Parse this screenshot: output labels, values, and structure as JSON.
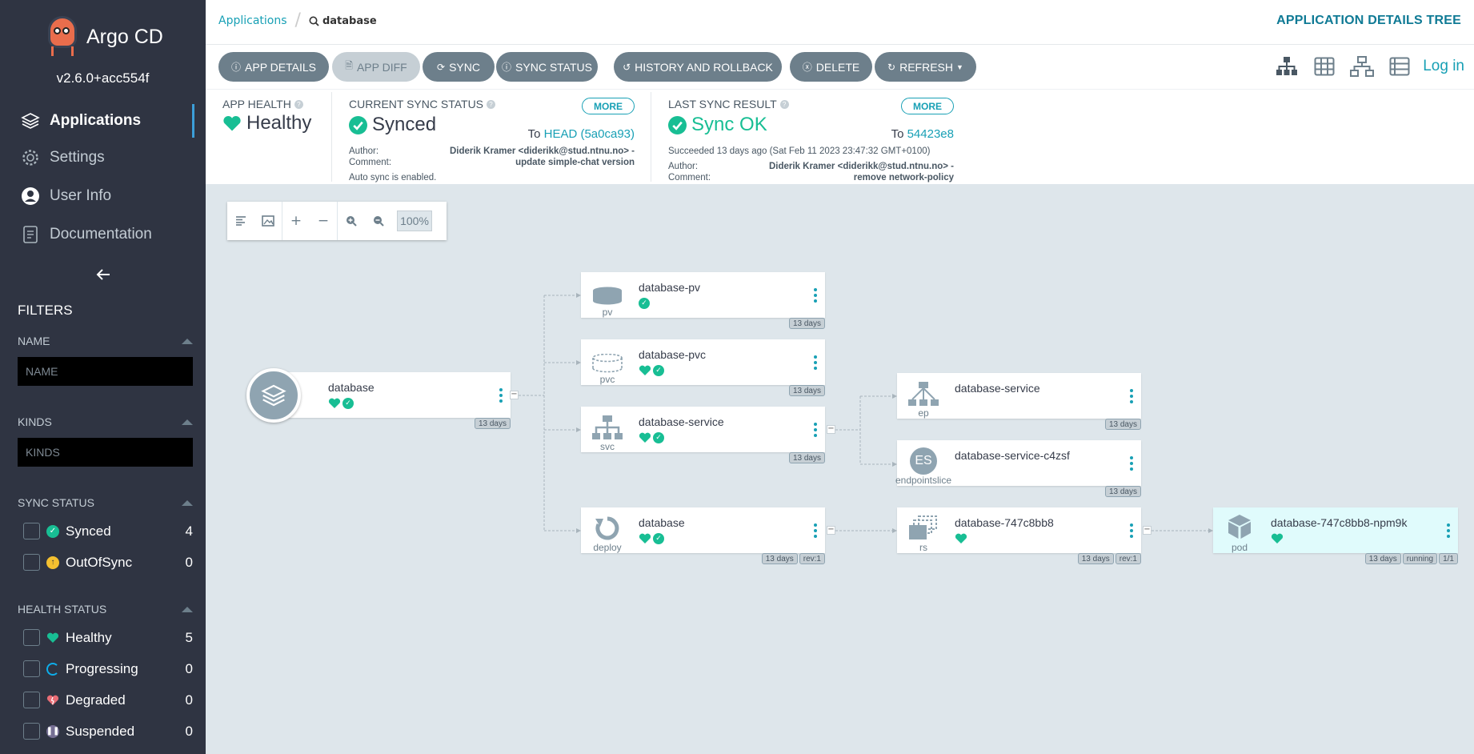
{
  "app": {
    "name": "Argo CD",
    "version": "v2.6.0+acc554f"
  },
  "nav": [
    {
      "label": "Applications"
    },
    {
      "label": "Settings"
    },
    {
      "label": "User Info"
    },
    {
      "label": "Documentation"
    }
  ],
  "filters": {
    "title": "FILTERS",
    "name": {
      "title": "NAME",
      "placeholder": "NAME"
    },
    "kinds": {
      "title": "KINDS",
      "placeholder": "KINDS"
    },
    "sync": {
      "title": "SYNC STATUS",
      "items": [
        {
          "label": "Synced",
          "count": "4"
        },
        {
          "label": "OutOfSync",
          "count": "0"
        }
      ]
    },
    "health": {
      "title": "HEALTH STATUS",
      "items": [
        {
          "label": "Healthy",
          "count": "5"
        },
        {
          "label": "Progressing",
          "count": "0"
        },
        {
          "label": "Degraded",
          "count": "0"
        },
        {
          "label": "Suspended",
          "count": "0"
        }
      ]
    }
  },
  "breadcrumb": {
    "root": "Applications",
    "current": "database"
  },
  "header": {
    "title": "APPLICATION DETAILS TREE"
  },
  "toolbar": {
    "app_details": "APP DETAILS",
    "app_diff": "APP DIFF",
    "sync": "SYNC",
    "sync_status": "SYNC STATUS",
    "history": "HISTORY AND ROLLBACK",
    "delete": "DELETE",
    "refresh": "REFRESH",
    "login": "Log in"
  },
  "status": {
    "health": {
      "label": "APP HEALTH",
      "value": "Healthy"
    },
    "sync": {
      "label": "CURRENT SYNC STATUS",
      "value": "Synced",
      "more": "MORE",
      "to_prefix": "To",
      "to_rev": "HEAD (5a0ca93)",
      "author_label": "Author:",
      "comment_label": "Comment:",
      "author": "Diderik Kramer <diderikk@stud.ntnu.no> -",
      "comment": "update simple-chat version",
      "auto": "Auto sync is enabled."
    },
    "last": {
      "label": "LAST SYNC RESULT",
      "value": "Sync OK",
      "more": "MORE",
      "to_prefix": "To",
      "to_rev": "54423e8",
      "succeeded": "Succeeded 13 days ago (Sat Feb 11 2023 23:47:32 GMT+0100)",
      "author_label": "Author:",
      "comment_label": "Comment:",
      "author": "Diderik Kramer <diderikk@stud.ntnu.no> -",
      "comment": "remove network-policy"
    }
  },
  "graph": {
    "zoom": "100%"
  },
  "nodes": {
    "root": {
      "name": "database",
      "age": "13 days"
    },
    "pv": {
      "name": "database-pv",
      "kind": "pv",
      "age": "13 days"
    },
    "pvc": {
      "name": "database-pvc",
      "kind": "pvc",
      "age": "13 days"
    },
    "svc": {
      "name": "database-service",
      "kind": "svc",
      "age": "13 days"
    },
    "deploy": {
      "name": "database",
      "kind": "deploy",
      "age": "13 days",
      "rev": "rev:1"
    },
    "ep": {
      "name": "database-service",
      "kind": "ep",
      "age": "13 days"
    },
    "eps": {
      "name": "database-service-c4zsf",
      "kind": "endpointslice",
      "age": "13 days",
      "abbr": "ES"
    },
    "rs": {
      "name": "database-747c8bb8",
      "kind": "rs",
      "age": "13 days",
      "rev": "rev:1"
    },
    "pod": {
      "name": "database-747c8bb8-npm9k",
      "kind": "pod",
      "age": "13 days",
      "state": "running",
      "ready": "1/1"
    }
  },
  "colors": {
    "accent": "#18a0b5",
    "healthy": "#18be94",
    "sidebar": "#2f3442",
    "button": "#6d7f8b"
  }
}
